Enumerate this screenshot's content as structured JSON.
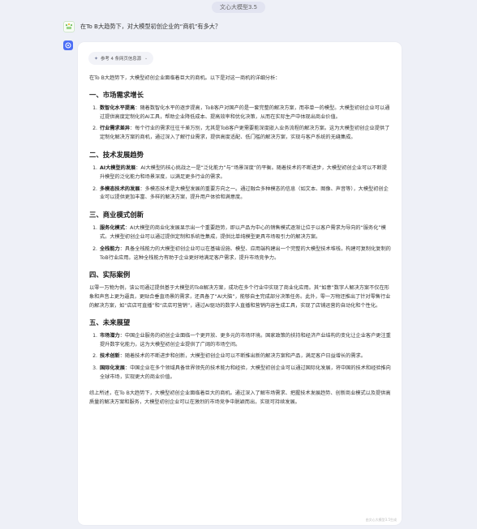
{
  "model_pill": "文心大模型3.5",
  "question": "在To B大趋势下，对大模型初创企业的“商机”有多大？",
  "reference_chip": "参考 4 条网页信息源",
  "intro": "在To B大趋势下，大模型初创企业面临着巨大的商机。以下是对这一商机的详细分析：",
  "sections": [
    {
      "title": "一、市场需求增长",
      "items": [
        {
          "num": "1.",
          "bold": "数智化水平提高",
          "text": "：随着数智化水平的逐步提高，ToB客户对国产的是一套完整的解决方案，而非单一的模型。大模型初创企业可以通过提供高度定制化的AI工具，帮助企业降低成本、提高效率和优化决策，从而在实际生产中体现出商业价值。"
        },
        {
          "num": "2.",
          "bold": "行业需求差异",
          "text": "：每个行业的需求往往千差万别，尤其是ToB客户更需要能深度嵌入业务流程的解决方案。这为大模型初创企业提供了定制化解决方案的商机，通过深入了解行业需求，提供高度适配、低门槛的解决方案，实现与客户系统的无缝集成。"
        }
      ]
    },
    {
      "title": "二、技术发展趋势",
      "items": [
        {
          "num": "1.",
          "bold": "AI大模型的发展",
          "text": "：AI大模型的核心挑战之一是“泛化能力”与“场景深度”的平衡。随着技术的不断进步，大模型初创企业可以不断提升模型的泛化能力和场景深度，以满足更多行业的需求。"
        },
        {
          "num": "2.",
          "bold": "多模态技术的发展",
          "text": "：多模态技术是大模型发展的重要方向之一。通过融合多种模态的信息（如文本、图像、声音等），大模型初创企业可以提供更加丰富、多样的解决方案，提升用户体验和满意度。"
        }
      ]
    },
    {
      "title": "三、商业模式创新",
      "items": [
        {
          "num": "1.",
          "bold": "服务化模式",
          "text": "：AI大模型的商业化发展显示出一个重要趋势，即以产品为中心的销售模式逐渐让位于以客户需求为导向的“服务化”模式。大模型初创企业可以通过提供定制和系统性集成，提供比单纯模型更具市场吸引力的解决方案。"
        },
        {
          "num": "2.",
          "bold": "全栈能力",
          "text": "：具备全栈能力的大模型初创企业可以在基础设施、模型、应用端构建出一个完整的大模型技术堆栈，构建可复制化复制的ToB行业应用。这种全栈能力有助于企业更好地满足客户需求，提升市场竞争力。"
        }
      ]
    }
  ],
  "case_section": {
    "title": "四、实际案例",
    "text": "以零一万物为例，该公司通过提供基于大模型的ToB解决方案，成功在多个行业中实现了商业化应用。其“如意”数字人解决方案不仅在形象和声音上更为逼真，更贴合垂直场景的需求，还具备了“AI大脑”，能够自主完成部分决策任务。此外，零一万物还推出了针对零售行业的解决方案，如“店店可直播”和“店店可营销”，通过AI驱动的数字人直播和营销内容生成工具，实现了店铺运营的自动化和个性化。"
  },
  "future_section": {
    "title": "五、未来展望",
    "items": [
      {
        "num": "1.",
        "bold": "市场潜力",
        "text": "：中国企业服务的初创企业面临一个更开放、更多元的市场环境。国家政策的扶持和经济产业结构的变化让企业客户更注重提升数字化能力，这为大模型初创企业提供了广阔的市场空间。"
      },
      {
        "num": "2.",
        "bold": "技术创新",
        "text": "：随着技术的不断进步和创新，大模型初创企业可以不断推出新的解决方案和产品，满足客户日益增长的需求。"
      },
      {
        "num": "3.",
        "bold": "国际化发展",
        "text": "：中国企业在多个领域具备世界领先的技术能力和经验，大模型初创企业可以通过国际化发展，将中国的技术和经验推向全球市场，实现更大的商业价值。"
      }
    ]
  },
  "conclusion": "综上所述，在To B大趋势下，大模型初创企业面临着巨大的商机。通过深入了解市场需求、把握技术发展趋势、创新商业模式以及提供高质量的解决方案和服务，大模型初创企业可以在激烈的市场竞争中脱颖而出，实现可持续发展。",
  "watermark": "由文心大模型3.5生成"
}
